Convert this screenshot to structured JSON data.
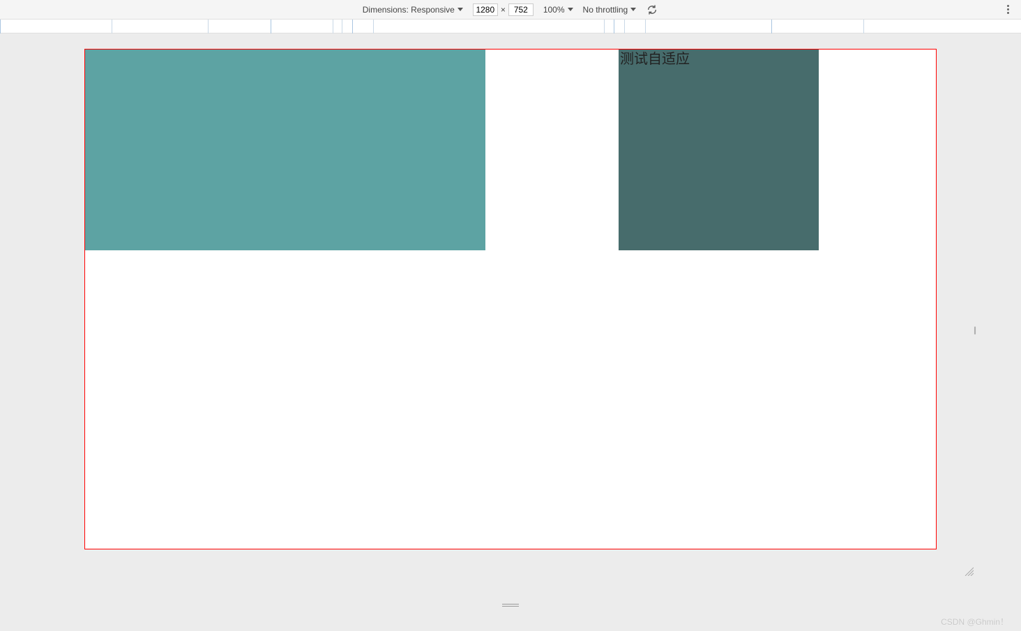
{
  "toolbar": {
    "dimensions_label": "Dimensions: Responsive",
    "width_value": "1280",
    "height_value": "752",
    "separator": "×",
    "zoom_label": "100%",
    "throttling_label": "No throttling"
  },
  "content": {
    "box_b_text": "测试自适应"
  },
  "watermark": "CSDN @Ghmin！",
  "ruler_ticks": [
    0,
    160,
    298,
    388,
    477,
    490,
    505,
    535,
    866,
    880,
    895,
    925,
    1106,
    1238
  ]
}
